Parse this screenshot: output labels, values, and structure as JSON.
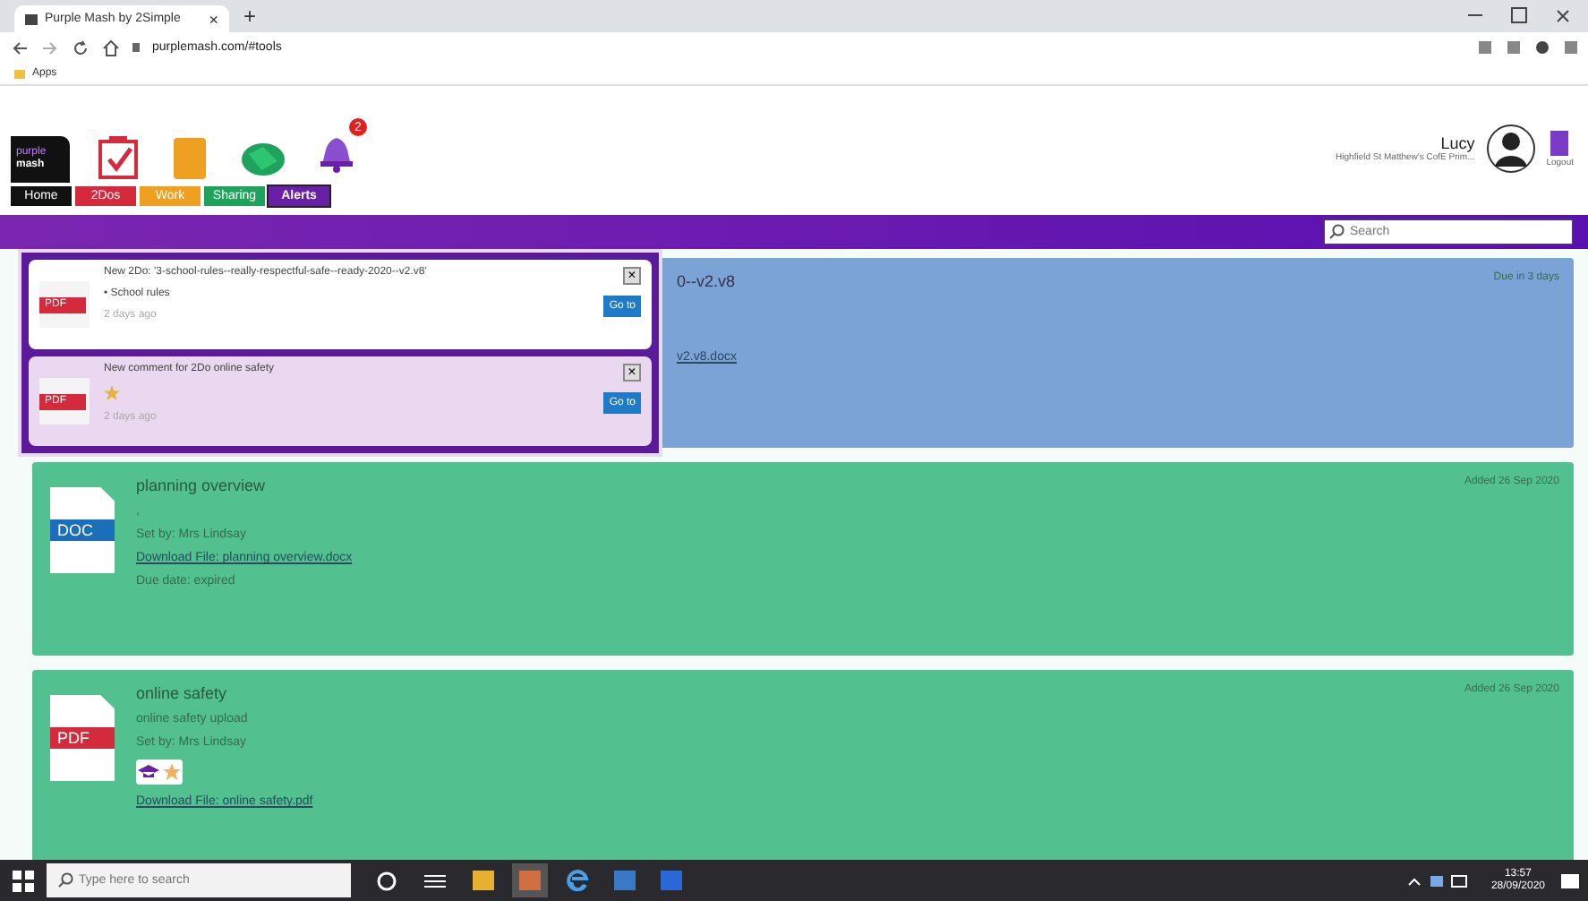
{
  "browser": {
    "tab_title": "Purple Mash by 2Simple",
    "tab_close": "×",
    "new_tab": "+",
    "address": "purplemash.com/#tools",
    "bookmark": "Apps"
  },
  "header": {
    "logo_top": "purple",
    "logo_bottom": "mash",
    "alert_count": "2",
    "nav": [
      {
        "label": "Home",
        "color": "#111111",
        "selected": false
      },
      {
        "label": "2Dos",
        "color": "#d42a3c",
        "selected": false
      },
      {
        "label": "Work",
        "color": "#f0a020",
        "selected": false
      },
      {
        "label": "Sharing",
        "color": "#1fa35c",
        "selected": false
      },
      {
        "label": "Alerts",
        "color": "#6a1fa8",
        "selected": true
      }
    ],
    "user_name": "Lucy",
    "school": "Highfield St Matthew's CofE Prim...",
    "logout": "Logout"
  },
  "search": {
    "placeholder": "Search"
  },
  "alerts": [
    {
      "type": "PDF",
      "title": "New 2Do: '3-school-rules--really-respectful-safe--ready-2020--v2.v8'",
      "tag": "• School rules",
      "time": "2 days ago",
      "unread": false,
      "close": "×",
      "action": "Go to"
    },
    {
      "type": "PDF",
      "title": "New comment for 2Do online safety",
      "time": "2 days ago",
      "unread": true,
      "close": "×",
      "action": "Go to"
    }
  ],
  "cards": [
    {
      "color": "#7ba3d6",
      "covered": true,
      "title": "0--v2.v8",
      "link": "v2.v8.docx",
      "date": "Due in 3 days",
      "badges": false
    },
    {
      "color": "#52c08f",
      "covered": false,
      "type": "DOC",
      "title": "planning overview",
      "lines": [
        ",",
        "Set by: Mrs Lindsay"
      ],
      "link": "Download File: planning overview.docx",
      "footer": "Due date: expired",
      "date": "Added 26 Sep 2020",
      "badges": false
    },
    {
      "color": "#52c08f",
      "covered": false,
      "type": "PDF",
      "title": "online safety",
      "lines": [
        "online safety upload",
        "Set by: Mrs Lindsay"
      ],
      "link": "Download File: online safety.pdf",
      "date": "Added 26 Sep 2020",
      "badges": true
    }
  ],
  "taskbar": {
    "search_placeholder": "Type here to search",
    "time": "13:57",
    "date": "28/09/2020"
  }
}
